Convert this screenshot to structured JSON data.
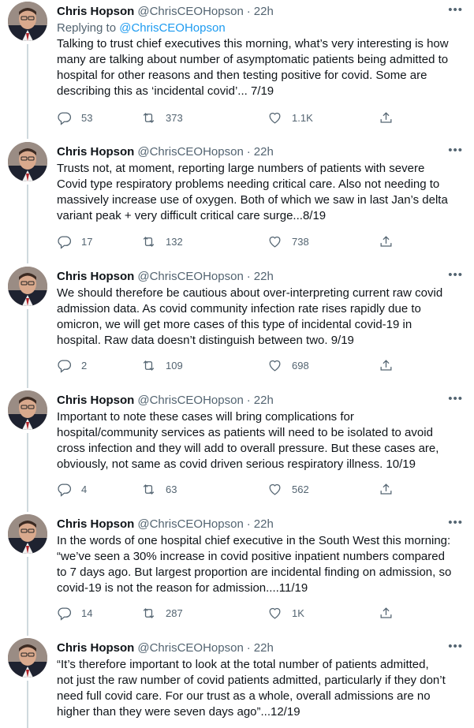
{
  "thread": {
    "tweets": [
      {
        "name": "Chris Hopson",
        "handle": "@ChrisCEOHopson",
        "time": "22h",
        "replying_prefix": "Replying to",
        "replying_mention": "@ChrisCEOHopson",
        "lines": [
          "Talking to trust chief executives this morning, what’s very interesting is how",
          "many are talking about number of asymptomatic patients being admitted to",
          "hospital for other reasons and then testing positive for covid. Some are",
          "describing this as ‘incidental covid’... 7/19"
        ],
        "replies": "53",
        "retweets": "373",
        "likes": "1.1K"
      },
      {
        "name": "Chris Hopson",
        "handle": "@ChrisCEOHopson",
        "time": "22h",
        "lines": [
          "Trusts not, at moment, reporting large numbers of patients with severe",
          "Covid type respiratory problems needing critical care. Also not needing to",
          "massively increase use of oxygen. Both of which we saw in last Jan’s delta",
          "variant peak + very difficult critical care surge...8/19"
        ],
        "replies": "17",
        "retweets": "132",
        "likes": "738"
      },
      {
        "name": "Chris Hopson",
        "handle": "@ChrisCEOHopson",
        "time": "22h",
        "lines": [
          "We should therefore be cautious about over-interpreting current raw covid",
          "admission data. As covid community infection rate rises rapidly due to",
          "omicron, we will get more cases of this type of incidental covid-19 in",
          "hospital. Raw data doesn’t distinguish between two. 9/19"
        ],
        "replies": "2",
        "retweets": "109",
        "likes": "698"
      },
      {
        "name": "Chris Hopson",
        "handle": "@ChrisCEOHopson",
        "time": "22h",
        "lines": [
          "Important to note these cases will bring complications for",
          "hospital/community services as patients will need to be isolated to avoid",
          "cross infection and they will add to overall pressure. But these cases are,",
          "obviously, not same as covid driven serious respiratory illness. 10/19"
        ],
        "replies": "4",
        "retweets": "63",
        "likes": "562"
      },
      {
        "name": "Chris Hopson",
        "handle": "@ChrisCEOHopson",
        "time": "22h",
        "lines": [
          "In the words of one hospital chief executive in the South West this morning:",
          "“we’ve seen a 30% increase in covid positive inpatient numbers compared",
          "to 7 days ago. But largest proportion are incidental finding on admission, so",
          "covid-19 is not the reason for admission....11/19"
        ],
        "replies": "14",
        "retweets": "287",
        "likes": "1K"
      },
      {
        "name": "Chris Hopson",
        "handle": "@ChrisCEOHopson",
        "time": "22h",
        "lines": [
          "“It’s therefore important to look at the total number of patients admitted,",
          "not just the raw number of covid patients admitted, particularly if they don’t",
          "need full covid care. For our trust as a whole, overall admissions are no",
          "higher than they were seven days ago”...12/19"
        ]
      }
    ],
    "icons": {
      "reply": "reply-icon",
      "retweet": "retweet-icon",
      "like": "heart-icon",
      "share": "share-icon",
      "more": "more-icon"
    },
    "colors": {
      "link": "#1d9bf0",
      "secondary_text": "#536471",
      "thread_line": "#cfd9de"
    }
  }
}
